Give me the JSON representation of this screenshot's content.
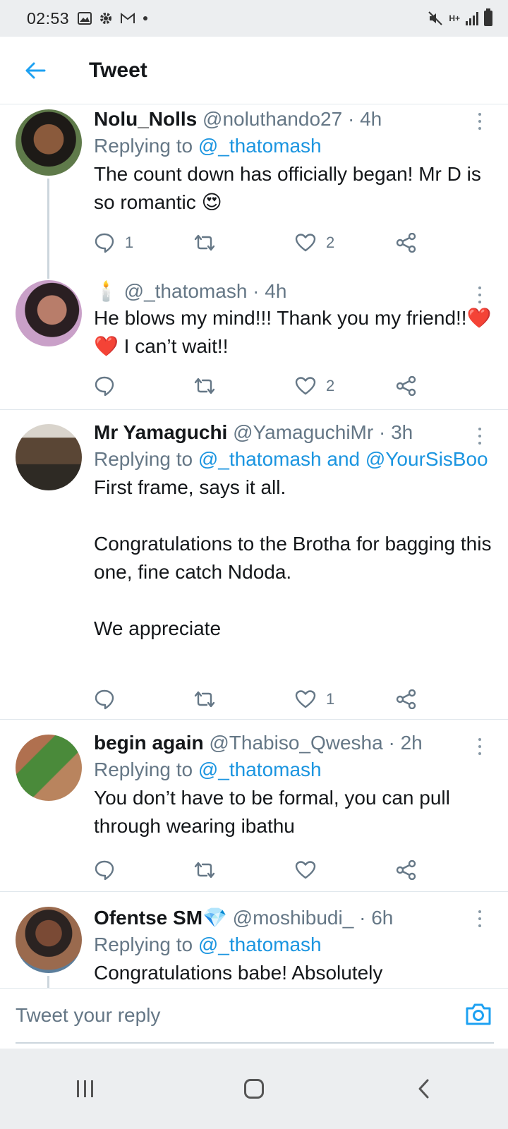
{
  "status_bar": {
    "time": "02:53",
    "left_icons": [
      "image-icon",
      "gear-icon",
      "gmail-icon",
      "dot-icon"
    ],
    "right_icons": [
      "mute-icon",
      "data-icon",
      "signal-icon",
      "battery-icon"
    ],
    "network": "H+"
  },
  "header": {
    "title": "Tweet",
    "back_icon": "arrow-left-icon",
    "accent": "#1da1f2"
  },
  "tweets": [
    {
      "name": "Nolu_Nolls",
      "handle": "@noluthando27",
      "time": "4h",
      "replying_prefix": "Replying to",
      "replying_to": "@_thatomash",
      "text": "The count down has officially began! Mr D is so romantic 😍",
      "reply_count": "1",
      "retweet_count": "",
      "like_count": "2"
    },
    {
      "name": "🕯️",
      "handle": "@_thatomash",
      "time": "4h",
      "text": "He blows my mind!!! Thank you my friend!!❤️❤️ I can’t wait!!",
      "reply_count": "",
      "retweet_count": "",
      "like_count": "2"
    },
    {
      "name": "Mr Yamaguchi",
      "handle": "@YamaguchiMr",
      "time": "3h",
      "replying_prefix": "Replying to",
      "replying_to": "@_thatomash and @YourSisBoo",
      "text": "First frame, says it all.\n\nCongratulations to the Brotha for bagging this one, fine catch Ndoda.\n\nWe appreciate",
      "reply_count": "",
      "retweet_count": "",
      "like_count": "1"
    },
    {
      "name": "begin again",
      "handle": "@Thabiso_Qwesha",
      "time": "2h",
      "replying_prefix": "Replying to",
      "replying_to": "@_thatomash",
      "text": "You don’t have to be formal, you can pull through wearing ibathu",
      "reply_count": "",
      "retweet_count": "",
      "like_count": ""
    },
    {
      "name": "Ofentse SM💎",
      "handle": "@moshibudi_",
      "time": "6h",
      "replying_prefix": "Replying to",
      "replying_to": "@_thatomash",
      "text": "Congratulations babe! Absolutely",
      "reply_count": "",
      "retweet_count": "",
      "like_count": ""
    }
  ],
  "reply_bar": {
    "placeholder": "Tweet your reply",
    "camera_icon": "camera-icon"
  },
  "nav_bar": {
    "buttons": [
      "recent-apps-icon",
      "home-icon",
      "back-icon"
    ]
  },
  "colors": {
    "link": "#1b95e0",
    "secondary": "#657786",
    "divider": "#e1e8ed",
    "thread": "#ccd6dd"
  }
}
